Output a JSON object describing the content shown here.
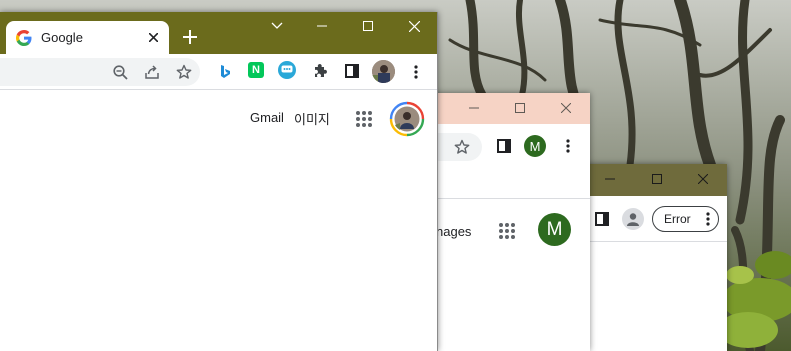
{
  "desktop": {
    "wallpaper": "forest-photo"
  },
  "window_front": {
    "tab": {
      "favicon": "google-g-icon",
      "title": "Google",
      "close_icon": "close-icon"
    },
    "new_tab_icon": "plus-icon",
    "caption_buttons": [
      "chevron-down-icon",
      "minimize-icon",
      "maximize-icon",
      "close-icon"
    ],
    "toolbar_icons": [
      "zoom-icon",
      "share-icon",
      "bookmark-star-icon",
      "extension-bing-icon",
      "extension-naver-icon",
      "extension-chat-icon",
      "puzzle-icon",
      "side-panel-icon",
      "profile-avatar",
      "more-vert-icon"
    ],
    "extension_naver_label": "N",
    "header_links": {
      "gmail": "Gmail",
      "images": "이미지"
    },
    "apps_icon": "apps-grid-icon",
    "account_icon": "account-avatar"
  },
  "window_middle": {
    "frame_color": "#f6d3c5",
    "caption_buttons": [
      "minimize-icon",
      "maximize-icon",
      "close-icon"
    ],
    "profile_initial": "M",
    "profile_color": "#2d6a1f",
    "images_link_partial": "nages",
    "account_initial": "M",
    "account_color": "#2d6a1f"
  },
  "window_back": {
    "frame_color": "#6f6b3c",
    "caption_buttons": [
      "minimize-icon",
      "maximize-icon",
      "close-icon"
    ],
    "error_chip": "Error"
  },
  "colors": {
    "front_frame": "#6b6b1c",
    "accent_blue": "#1a73e8"
  }
}
